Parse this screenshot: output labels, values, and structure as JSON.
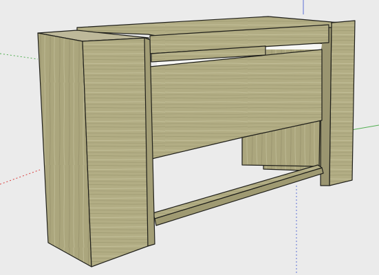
{
  "viewport": {
    "background_color": "#ebebeb",
    "tool": "orbit"
  },
  "axes": {
    "red_color": "#d93b3b",
    "green_color": "#4fae4f",
    "blue_color": "#5b6fd6"
  },
  "model": {
    "wood_light": "#b9b48a",
    "wood_mid": "#a7a178",
    "wood_dark": "#8e8963",
    "top_face_color": "#beb99a",
    "edge_color": "#1f1f1a",
    "background_panel_color": "#f7f7f5"
  }
}
